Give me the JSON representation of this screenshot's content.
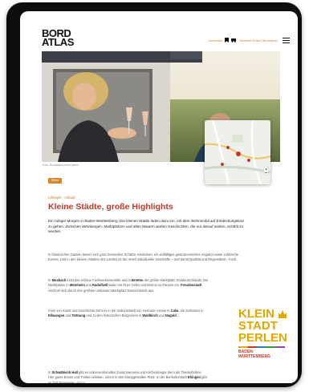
{
  "logo": {
    "line1": "BORD",
    "line2": "ATLAS"
  },
  "topnav": {
    "link1": "Anmelden",
    "link2": "Weltweit finden (Bordatlas)"
  },
  "hero": {
    "caption": "Foto: Bordatlas/Lorem Ipsum"
  },
  "article": {
    "badge": "Reise",
    "kicker": "Lifestyle · Urlaub",
    "headline": "Kleine Städte, große Highlights",
    "lead": "Ein ruhiger Morgen in Baden-Württemberg: Die kleinen Städte laden dazu ein, mit dem Wohnmobil auf Entdeckungstour zu gehen. Zwischen Weinbergen, Marktplätzen und alten Mauern warten Geschichten, die nur darauf warten, erzählt zu werden.",
    "p1": "In historischen Gassen lassen sich ganz besondere Schätze entdecken: ein vielfältiges gastronomisches Angebot sowie zahlreiche Events. Und in den kleinen Städten des Landes ist der Anteil individueller Geschäfte – und damit Qualität und Regionalität – hoch.",
    "p2_parts": [
      {
        "t": "In ",
        "b": false
      },
      {
        "t": "Mosbach",
        "b": true
      },
      {
        "t": " lockt das schöne Fachwerkensemble und in ",
        "b": false
      },
      {
        "t": "Bretten",
        "b": true
      },
      {
        "t": " der größte Marktplatz Süddeutschlands. Die Marktplätze in ",
        "b": false
      },
      {
        "t": "Weinheim",
        "b": true
      },
      {
        "t": " und ",
        "b": false
      },
      {
        "t": "Radolfzell",
        "b": true
      },
      {
        "t": " laden mit ihren Cafés und Bistros zu Pausen ein. ",
        "b": false
      },
      {
        "t": "Freudenstadt",
        "b": true
      },
      {
        "t": " zeichnet sich durch den größten umbauten Marktplatz Deutschlands aus.",
        "b": false
      }
    ],
    "p3_parts": [
      {
        "t": "Fans von Kunst und Geschichte zieht es in die Geburtsstadt von Hermann Hesse in ",
        "b": false
      },
      {
        "t": "Calw",
        "b": true
      },
      {
        "t": ", die Schlösser in ",
        "b": false
      },
      {
        "t": "Ellwangen",
        "b": true
      },
      {
        "t": " und ",
        "b": false
      },
      {
        "t": "Tettnang",
        "b": true
      },
      {
        "t": " und zu den historischen Burgruinen in ",
        "b": false
      },
      {
        "t": "Waldkirch",
        "b": true
      },
      {
        "t": " und ",
        "b": false
      },
      {
        "t": "Nagold",
        "b": true
      },
      {
        "t": ".",
        "b": false
      }
    ],
    "p4_parts": [
      {
        "t": "In ",
        "b": false
      },
      {
        "t": "Schwäbisch Hall",
        "b": true
      },
      {
        "t": " gibt es unkonventionelles Zusammensein und Kirchentreppe dient als Theaterbühne. Hier gutes Essen und Trinken erleben, nimmt in den Klanggestalten Platz. In der Bierkulturstadt ",
        "b": false
      },
      {
        "t": "Ehingen",
        "b": true
      },
      {
        "t": " gibt es fünf Brauereien und in",
        "b": false
      }
    ]
  },
  "kleinstadt": {
    "line1": "KLEIN",
    "line2": "STADT",
    "line3": "PERLEN",
    "sub1": "BADEN-",
    "sub2": "WÜRTTEMBERG"
  },
  "colors": {
    "accent": "#c0392b",
    "orange": "#d48a2c",
    "gold": "#e2a800"
  }
}
